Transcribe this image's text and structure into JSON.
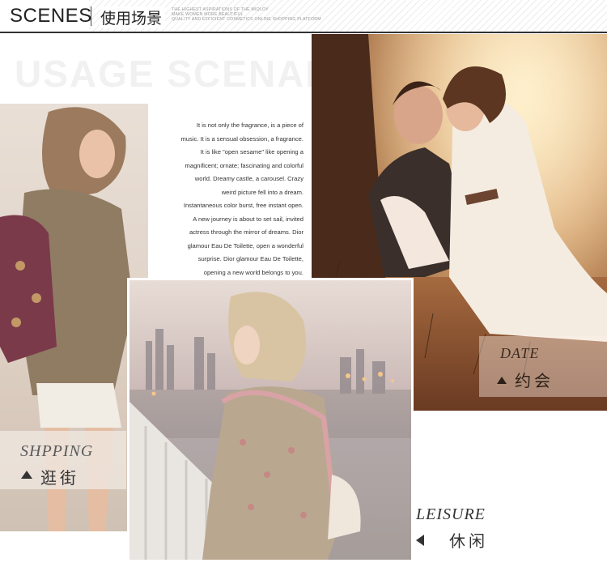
{
  "header": {
    "title_en": "SCENES",
    "title_cn": "使用场景",
    "tagline": [
      "THE HIGHEST ASPIRATIONS OF THE MIQLOY",
      "MAKE WOMEN MORE BEAUTIFUL",
      "QUALITY AND EFFICIENT COSMETICS ONLINE SHOPPING PLATFORM"
    ]
  },
  "watermark": "USAGE SCENARIOS",
  "paragraph": [
    "It is not only the fragrance, is a piece of",
    "music. It is a sensual obsession, a fragrance.",
    "It is like \"open sesame\" like opening a",
    "magnificent; ornate; fascinating and colorful",
    "world. Dreamy castle, a carousel. Crazy",
    "weird picture fell into a dream.",
    "Instantaneous color burst, free instant open.",
    "A new journey is about to set sail, invited",
    "actress through the mirror of dreams. Dior",
    "glamour Eau De Toilette, open a wonderful",
    "surprise. Dior glamour Eau De Toilette,",
    "opening a new world belongs to you."
  ],
  "scenes": {
    "shopping": {
      "en": "SHPPING",
      "cn": "逛街"
    },
    "date": {
      "en": "DATE",
      "cn": "约会"
    },
    "leisure": {
      "en": "LEISURE",
      "cn": "休闲"
    }
  },
  "colors": {
    "header_rule": "#333333",
    "watermark": "#f1f1f1",
    "date_tone": "#c08a57",
    "leisure_sky": "#e8dcd6"
  }
}
